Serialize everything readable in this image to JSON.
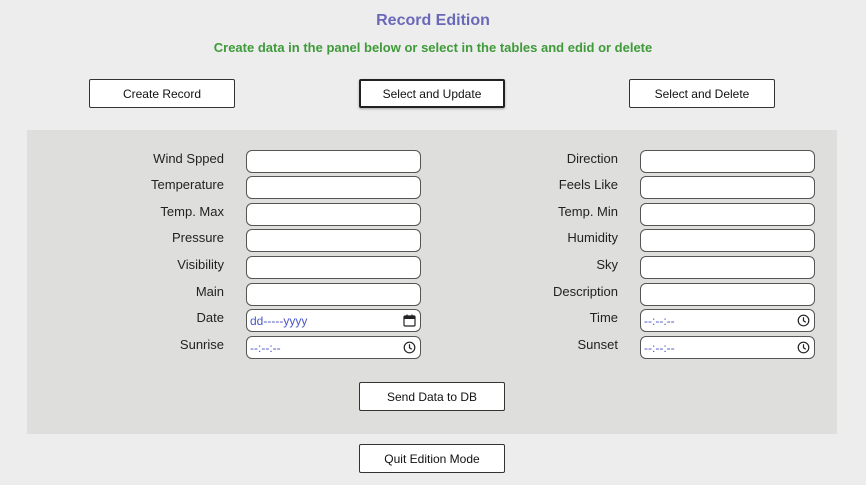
{
  "header": {
    "title": "Record Edition",
    "subtitle": "Create data in the panel below or select in the tables and edid or delete"
  },
  "mode_buttons": {
    "create": "Create Record",
    "update": "Select and Update",
    "delete": "Select and Delete"
  },
  "form": {
    "left": [
      {
        "label": "Wind Spped",
        "value": ""
      },
      {
        "label": "Temperature",
        "value": ""
      },
      {
        "label": "Temp. Max",
        "value": ""
      },
      {
        "label": "Pressure",
        "value": ""
      },
      {
        "label": "Visibility",
        "value": ""
      },
      {
        "label": "Main",
        "value": ""
      },
      {
        "label": "Date",
        "value": "dd-----yyyy"
      },
      {
        "label": "Sunrise",
        "value": "--:--:--"
      }
    ],
    "right": [
      {
        "label": "Direction",
        "value": ""
      },
      {
        "label": "Feels Like",
        "value": ""
      },
      {
        "label": "Temp. Min",
        "value": ""
      },
      {
        "label": "Humidity",
        "value": ""
      },
      {
        "label": "Sky",
        "value": ""
      },
      {
        "label": "Description",
        "value": ""
      },
      {
        "label": "Time",
        "value": "--:--:--"
      },
      {
        "label": "Sunset",
        "value": "--:--:--"
      }
    ],
    "send_label": "Send Data to DB"
  },
  "footer": {
    "quit_label": "Quit Edition Mode"
  },
  "colors": {
    "title": "#6a68b8",
    "subtitle": "#3f9a3a",
    "panel_bg": "#dededc",
    "page_bg": "#ecedec",
    "placeholder": "#4a57c8"
  },
  "icons": {
    "date": "calendar-icon",
    "time": "clock-icon"
  }
}
